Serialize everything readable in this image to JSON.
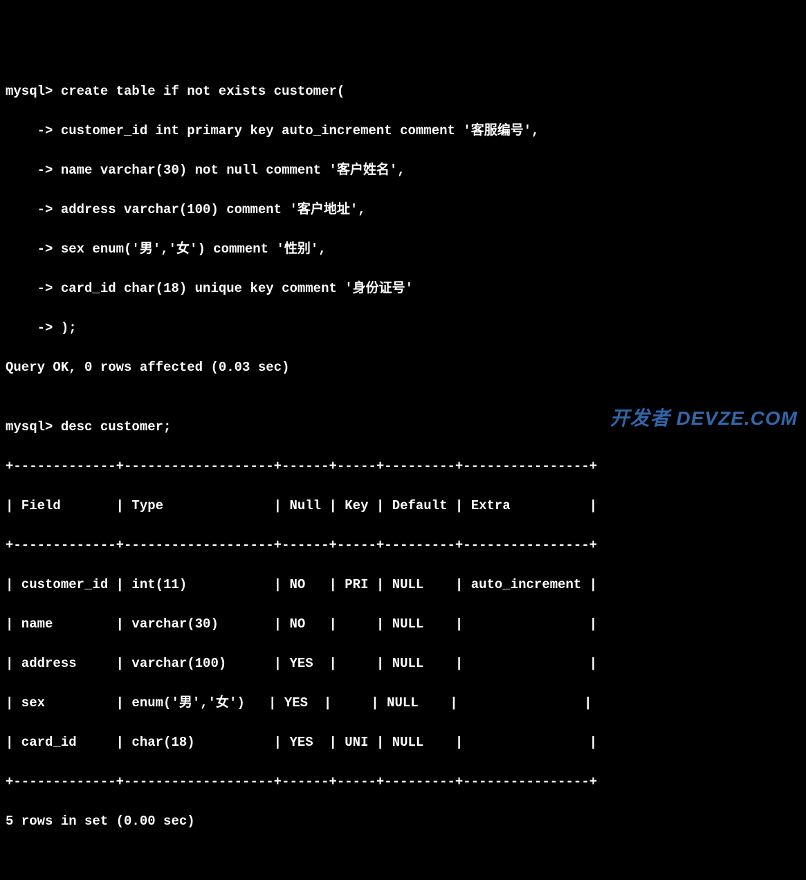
{
  "lines": {
    "l1": "mysql> create table if not exists customer(",
    "l2": "    -> customer_id int primary key auto_increment comment '客服编号',",
    "l3": "    -> name varchar(30) not null comment '客户姓名',",
    "l4": "    -> address varchar(100) comment '客户地址',",
    "l5": "    -> sex enum('男','女') comment '性别',",
    "l6": "    -> card_id char(18) unique key comment '身份证号'",
    "l7": "    -> );",
    "l8": "Query OK, 0 rows affected (0.03 sec)",
    "l9": "",
    "l10": "mysql> desc customer;",
    "l11": "+-------------+-------------------+------+-----+---------+----------------+",
    "l12": "| Field       | Type              | Null | Key | Default | Extra          |",
    "l13": "+-------------+-------------------+------+-----+---------+----------------+",
    "l14": "| customer_id | int(11)           | NO   | PRI | NULL    | auto_increment |",
    "l15": "| name        | varchar(30)       | NO   |     | NULL    |                |",
    "l16": "| address     | varchar(100)      | YES  |     | NULL    |                |",
    "l17": "| sex         | enum('男','女')   | YES  |     | NULL    |                |",
    "l18": "| card_id     | char(18)          | YES  | UNI | NULL    |                |",
    "l19": "+-------------+-------------------+------+-----+---------+----------------+",
    "l20": "5 rows in set (0.00 sec)"
  },
  "chart_data": {
    "type": "table",
    "title": "desc customer",
    "columns": [
      "Field",
      "Type",
      "Null",
      "Key",
      "Default",
      "Extra"
    ],
    "rows": [
      [
        "customer_id",
        "int(11)",
        "NO",
        "PRI",
        "NULL",
        "auto_increment"
      ],
      [
        "name",
        "varchar(30)",
        "NO",
        "",
        "NULL",
        ""
      ],
      [
        "address",
        "varchar(100)",
        "YES",
        "",
        "NULL",
        ""
      ],
      [
        "sex",
        "enum('男','女')",
        "YES",
        "",
        "NULL",
        ""
      ],
      [
        "card_id",
        "char(18)",
        "YES",
        "UNI",
        "NULL",
        ""
      ]
    ]
  },
  "watermark": "开发者 DEVZE.COM"
}
